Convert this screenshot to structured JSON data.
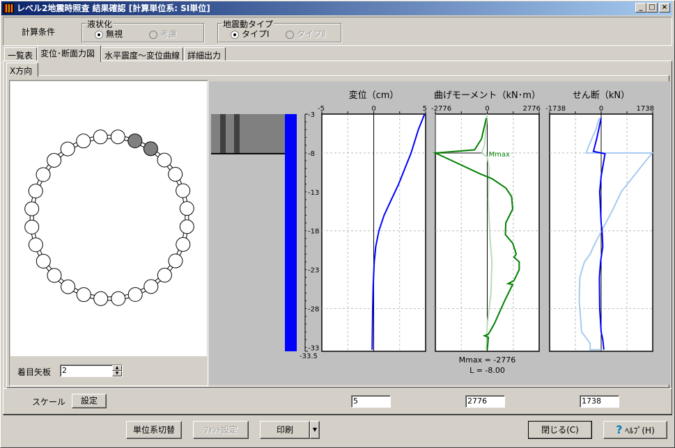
{
  "window": {
    "title": "レベル2地震時照査 結果確認 [計算単位系: SI単位]",
    "min": "_",
    "max": "□",
    "close": "×"
  },
  "conditions": {
    "label": "計算条件",
    "liquefaction": {
      "label": "液状化",
      "options": [
        "無視",
        "考慮"
      ],
      "selected": 0
    },
    "motion": {
      "label": "地震動タイプ",
      "options": [
        "タイプⅠ",
        "タイプⅡ"
      ],
      "selected": 0
    }
  },
  "tabs": [
    "一覧表",
    "変位･断面力図",
    "水平震度～変位曲線",
    "詳細出力"
  ],
  "active_tab": 1,
  "subtab": "X方向",
  "sheet": {
    "label": "着目矢板",
    "value": "2"
  },
  "depth_axis": {
    "labels": [
      "-3",
      "-8",
      "-13",
      "-18",
      "-23",
      "-28",
      "-33"
    ],
    "bottom": "-33.5",
    "ticks": [
      -3,
      -8,
      -13,
      -18,
      -23,
      -28,
      -33
    ],
    "min": -33.5,
    "max": -3,
    "soil_layer_bottom": -8
  },
  "plots": [
    {
      "title": "変位（cm）",
      "ticks": [
        "-5",
        "0",
        "5"
      ],
      "range": 5,
      "series": [
        {
          "color": "#0000ff",
          "width": 2,
          "points": [
            [
              4.9,
              -3
            ],
            [
              4.3,
              -5
            ],
            [
              3.6,
              -8
            ],
            [
              3.0,
              -10
            ],
            [
              2.4,
              -12
            ],
            [
              1.7,
              -14
            ],
            [
              1.0,
              -16
            ],
            [
              0.5,
              -18
            ],
            [
              0.2,
              -20
            ],
            [
              0.05,
              -22
            ],
            [
              -0.05,
              -25
            ],
            [
              -0.1,
              -28
            ],
            [
              -0.15,
              -33.3
            ]
          ]
        }
      ]
    },
    {
      "title": "曲げモーメント（kN･m）",
      "ticks": [
        "-2776",
        "0",
        "2776"
      ],
      "range": 2776,
      "annotation": "Mmax",
      "mmax_text": "Mmax = -2776",
      "l_text": "L = -8.00",
      "series": [
        {
          "color": "#b8dcb8",
          "width": 2,
          "points": [
            [
              0,
              -3
            ],
            [
              -150,
              -7
            ],
            [
              -300,
              -8
            ],
            [
              0,
              -8.5
            ],
            [
              100,
              -10
            ],
            [
              50,
              -14
            ],
            [
              150,
              -19
            ],
            [
              250,
              -22
            ],
            [
              200,
              -26
            ],
            [
              0,
              -30
            ],
            [
              -50,
              -33.3
            ]
          ]
        },
        {
          "color": "#808080",
          "width": 2,
          "points": [
            [
              -2776,
              -3
            ],
            [
              -2776,
              -8
            ],
            [
              -300,
              -8
            ]
          ]
        },
        {
          "color": "#008000",
          "width": 2,
          "points": [
            [
              -50,
              -3.5
            ],
            [
              -310,
              -6.2
            ],
            [
              -680,
              -7.6
            ],
            [
              -2776,
              -8
            ],
            [
              -370,
              -10.7
            ],
            [
              250,
              -11.3
            ],
            [
              990,
              -12.5
            ],
            [
              1300,
              -13.6
            ],
            [
              1360,
              -15.2
            ],
            [
              990,
              -17
            ],
            [
              970,
              -18.5
            ],
            [
              1360,
              -19.6
            ],
            [
              1550,
              -21
            ],
            [
              1430,
              -21.4
            ],
            [
              1710,
              -22
            ],
            [
              1710,
              -23
            ],
            [
              1430,
              -24.4
            ],
            [
              1115,
              -24.8
            ],
            [
              1360,
              -24.9
            ],
            [
              930,
              -27
            ],
            [
              370,
              -30
            ],
            [
              60,
              -31.3
            ],
            [
              -150,
              -31.5
            ],
            [
              60,
              -31.7
            ],
            [
              0,
              -33.3
            ]
          ]
        }
      ]
    },
    {
      "title": "せん断（kN）",
      "ticks": [
        "-1738",
        "0",
        "1738"
      ],
      "range": 1738,
      "series": [
        {
          "color": "#a6caf0",
          "width": 2,
          "points": [
            [
              -60,
              -3.5
            ],
            [
              -180,
              -5
            ],
            [
              -410,
              -7
            ],
            [
              -505,
              -8
            ],
            [
              1720,
              -8
            ],
            [
              1300,
              -10
            ],
            [
              675,
              -13
            ],
            [
              365,
              -15.5
            ],
            [
              15,
              -18
            ],
            [
              -255,
              -20
            ],
            [
              -370,
              -21
            ],
            [
              -565,
              -22
            ],
            [
              -720,
              -24
            ],
            [
              -740,
              -27
            ],
            [
              -660,
              -31
            ],
            [
              -370,
              -32.5
            ],
            [
              -370,
              -33.3
            ],
            [
              0,
              -33.3
            ]
          ]
        },
        {
          "color": "#0000ff",
          "width": 2,
          "points": [
            [
              0,
              -3.5
            ],
            [
              -140,
              -6
            ],
            [
              -260,
              -7.8
            ],
            [
              130,
              -8.1
            ],
            [
              90,
              -9
            ],
            [
              0,
              -11
            ],
            [
              -50,
              -13
            ],
            [
              0,
              -17
            ],
            [
              30,
              -18
            ],
            [
              55,
              -20
            ],
            [
              -20,
              -22
            ],
            [
              -60,
              -24
            ],
            [
              -50,
              -28
            ],
            [
              0,
              -31
            ],
            [
              55,
              -32
            ],
            [
              90,
              -33.3
            ]
          ]
        }
      ]
    }
  ],
  "scale": {
    "label": "スケール",
    "button": "設定",
    "values": [
      "5",
      "2776",
      "1738"
    ]
  },
  "footer": {
    "units": "単位系切替",
    "font": "ﾌｫﾝﾄ設定",
    "print": "印刷",
    "close": "閉じる(C)",
    "help": "ﾍﾙﾌﾟ(H)"
  }
}
